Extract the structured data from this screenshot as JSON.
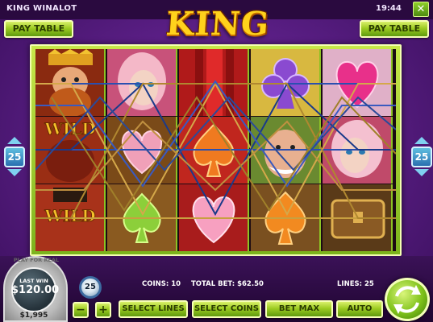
{
  "window": {
    "game_name": "KING WINALOT",
    "clock": "19:44",
    "close_label": "✕"
  },
  "logo": {
    "text": "KING WINALOT"
  },
  "buttons": {
    "paytable_left": "PAY TABLE",
    "paytable_right": "PAY TABLE",
    "minus": "−",
    "plus": "+",
    "select_lines": "SELECT LINES",
    "select_coins": "SELECT COINS",
    "bet_max": "BET MAX",
    "auto": "AUTO"
  },
  "side": {
    "lines_left": "25",
    "lines_right": "25"
  },
  "status": {
    "coins": "COINS: 10",
    "total_bet": "TOTAL BET: $62.50",
    "lines": "LINES: 25"
  },
  "balance": {
    "play_for_real": "PLAY FOR REAL",
    "last_win_label": "LAST WIN",
    "last_win_value": "$120.00",
    "credit": "$1,995"
  },
  "coin_value": "25",
  "reels": [
    [
      "king",
      "wild",
      "wild"
    ],
    [
      "princess",
      "heart",
      "spade"
    ],
    [
      "curtain",
      "spade",
      "heart"
    ],
    [
      "club",
      "jester",
      "spade"
    ],
    [
      "heart",
      "princess",
      "chest"
    ]
  ],
  "colors": {
    "accent_green": "#9dcc22",
    "frame": "#c8e84a",
    "background": "#5b1f86",
    "logo_gold": "#ffd21c"
  }
}
